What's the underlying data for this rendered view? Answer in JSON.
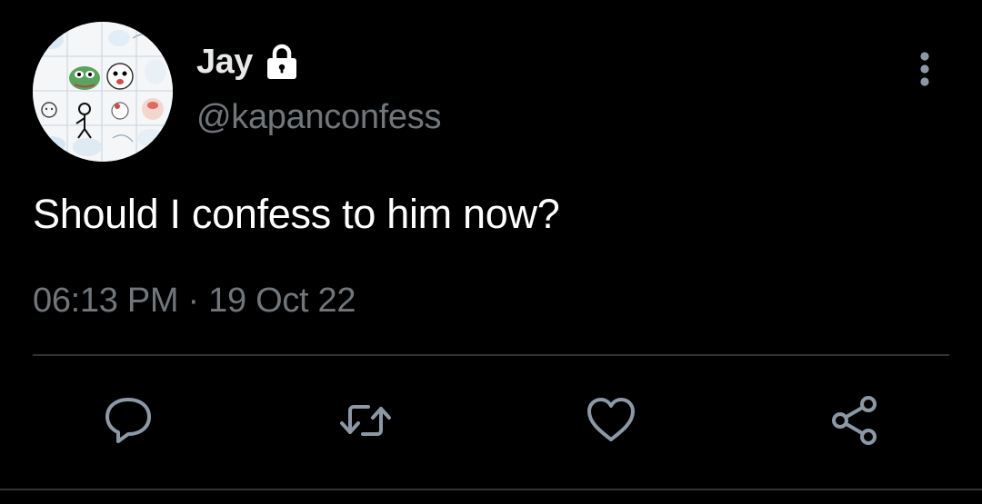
{
  "tweet": {
    "author": {
      "display_name": "Jay",
      "handle": "@kapanconfess",
      "protected_icon": "lock-icon",
      "avatar": "meme-sticker-collage"
    },
    "text": "Should I confess to him now?",
    "time": "06:13 PM",
    "separator": " · ",
    "date": "19 Oct 22"
  },
  "header": {
    "more_icon": "vertical-ellipsis-icon"
  },
  "actions": [
    {
      "name": "reply",
      "icon": "speech-bubble-icon"
    },
    {
      "name": "retweet",
      "icon": "retweet-arrows-icon"
    },
    {
      "name": "like",
      "icon": "heart-icon"
    },
    {
      "name": "share",
      "icon": "share-nodes-icon"
    }
  ],
  "colors": {
    "background": "#000000",
    "primary_text": "#e7e9ea",
    "secondary_text": "#71767b",
    "divider": "#2f3336"
  }
}
